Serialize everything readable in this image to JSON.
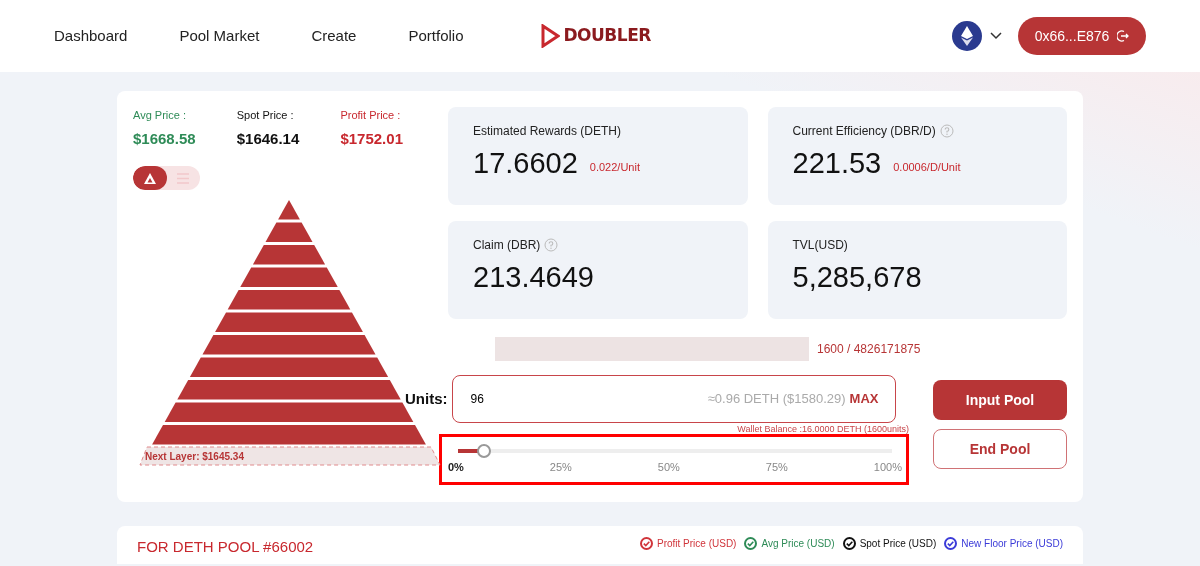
{
  "nav": {
    "links": [
      {
        "label": "Dashboard"
      },
      {
        "label": "Pool Market"
      },
      {
        "label": "Create"
      },
      {
        "label": "Portfolio"
      }
    ],
    "logo": "DOUBLER",
    "wallet": "0x66...E876"
  },
  "prices": [
    {
      "label": "Avg Price :",
      "value": "$1668.58",
      "color": "#2e8b57"
    },
    {
      "label": "Spot Price :",
      "value": "$1646.14",
      "color": "#111111"
    },
    {
      "label": "Profit Price :",
      "value": "$1752.01",
      "color": "#c8282e"
    }
  ],
  "views": [
    {
      "kind": "pyramid",
      "selected": true
    },
    {
      "kind": "list",
      "selected": false
    }
  ],
  "next_layer": "Next Layer: $1645.34",
  "stats": [
    {
      "label": "Estimated Rewards (DETH)",
      "help": false,
      "value": "17.6602",
      "sub": "0.022/Unit"
    },
    {
      "label": "Current Efficiency (DBR/D)",
      "help": true,
      "value": "221.53",
      "sub": "0.0006/D/Unit"
    },
    {
      "label": "Claim (DBR)",
      "help": true,
      "value": "213.4649"
    },
    {
      "label": "TVL(USD)",
      "help": false,
      "value": "5,285,678"
    }
  ],
  "supply": "1600 / 4826171875",
  "units": {
    "label": "Units:",
    "value": "96",
    "estimate": "≈0.96 DETH ($1580.29)",
    "max": "MAX",
    "balance": "Wallet Balance :16.0000 DETH (1600units)"
  },
  "slider": {
    "level": 0.06,
    "ticks": [
      "0%",
      "25%",
      "50%",
      "75%",
      "100%"
    ],
    "highlighted": true
  },
  "buttons": [
    {
      "label": "Input Pool",
      "kind": "primary"
    },
    {
      "label": "End Pool",
      "kind": "outline"
    }
  ],
  "pool": {
    "title": "FOR DETH POOL #66002",
    "legend": [
      {
        "label": "Profit Price (USD)",
        "color": "#d0343a"
      },
      {
        "label": "Avg Price (USD)",
        "color": "#2e8b57"
      },
      {
        "label": "Spot Price (USD)",
        "color": "#111111"
      },
      {
        "label": "New Floor Price (USD)",
        "color": "#3b3bd8"
      }
    ]
  }
}
